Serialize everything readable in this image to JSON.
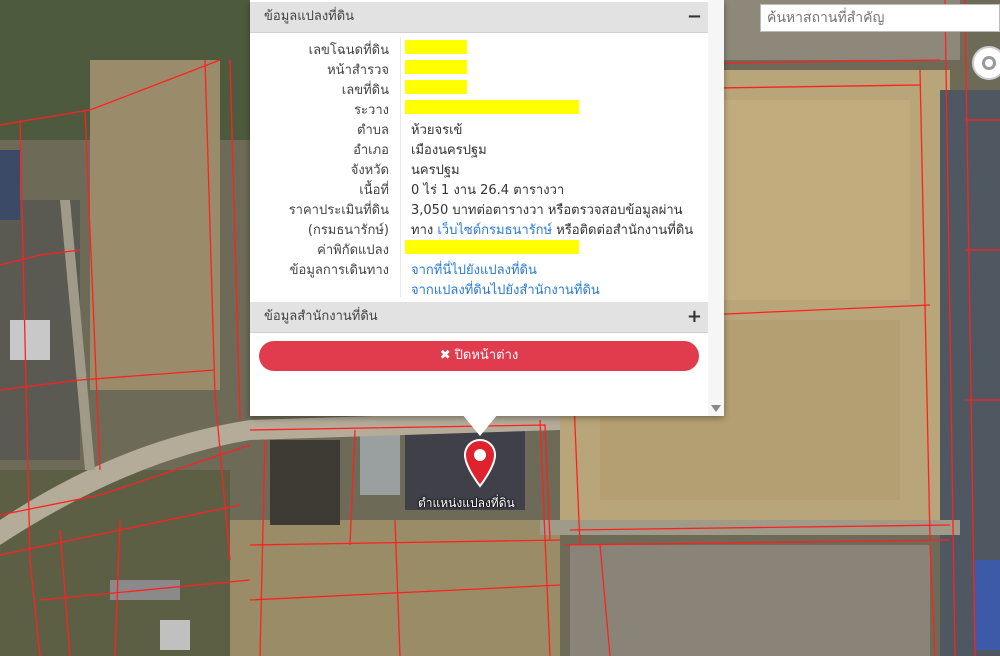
{
  "search": {
    "placeholder": "ค้นหาสถานที่สำคัญ"
  },
  "popup": {
    "section1_title": "ข้อมูลแปลงที่ดิน",
    "section1_toggle": "−",
    "rows": [
      {
        "label": "เลขโฉนดที่ดิน",
        "value": "",
        "redacted": true,
        "redact_width": 62
      },
      {
        "label": "หน้าสำรวจ",
        "value": "",
        "redacted": true,
        "redact_width": 62
      },
      {
        "label": "เลขที่ดิน",
        "value": "",
        "redacted": true,
        "redact_width": 62
      },
      {
        "label": "ระวาง",
        "value": "",
        "redacted": true,
        "redact_width": 174
      },
      {
        "label": "ตำบล",
        "value": "ห้วยจรเข้"
      },
      {
        "label": "อำเภอ",
        "value": "เมืองนครปฐม"
      },
      {
        "label": "จังหวัด",
        "value": "นครปฐม"
      },
      {
        "label": "เนื้อที่",
        "value": "0 ไร่ 1 งาน 26.4 ตารางวา"
      },
      {
        "label": "ราคาประเมินที่ดิน",
        "value": "3,050 บาทต่อตารางวา หรือตรวจสอบข้อมูลผ่าน"
      },
      {
        "label": "(กรมธนารักษ์)",
        "value_pre": "ทาง ",
        "value_link": "เว็บไซต์กรมธนารักษ์",
        "value_post": " หรือติดต่อสำนักงานที่ดิน"
      },
      {
        "label": "ค่าพิกัดแปลง",
        "value": "",
        "redacted": true,
        "redact_width": 174
      },
      {
        "label": "ข้อมูลการเดินทาง",
        "link": "จากที่นี่ไปยังแปลงที่ดิน"
      },
      {
        "label": "",
        "link": "จากแปลงที่ดินไปยังสำนักงานที่ดิน"
      }
    ],
    "section2_title": "ข้อมูลสำนักงานที่ดิน",
    "section2_toggle": "+",
    "close_label": "ปิดหน้าต่าง",
    "close_icon": "✖"
  },
  "marker": {
    "label": "ตำแหน่งแปลงที่ดิน",
    "color": "#e0222e"
  },
  "colors": {
    "parcel_lines": "#ff2020",
    "close_button": "#e03c4e",
    "redaction": "#ffff00"
  }
}
